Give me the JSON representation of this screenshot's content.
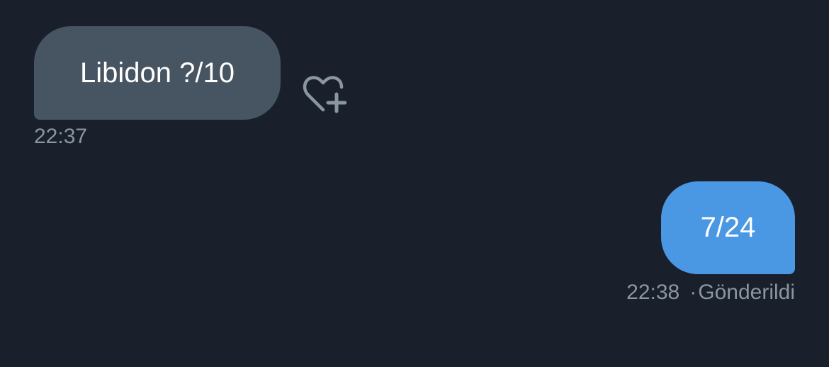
{
  "messages": {
    "received": {
      "text": "Libidon ?/10",
      "time": "22:37",
      "react_icon": "heart-plus-icon"
    },
    "sent": {
      "text": "7/24",
      "time": "22:38",
      "separator": "·",
      "status": "Gönderildi"
    }
  },
  "colors": {
    "background": "#19202b",
    "received_bubble": "#475462",
    "sent_bubble": "#4a97e4",
    "meta_text": "#8b96a3"
  }
}
